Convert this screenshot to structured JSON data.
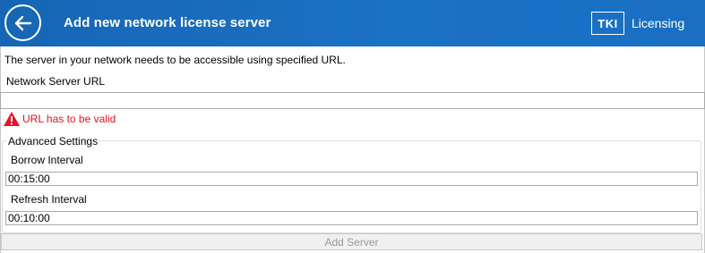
{
  "header": {
    "title": "Add new network license server",
    "back_icon": "arrow-left-icon",
    "brand_logo": "TKI",
    "brand_name": "Licensing",
    "background": "#1a6fc3"
  },
  "form": {
    "intro": "The server in your network needs to be accessible using specified URL.",
    "url_label": "Network Server URL",
    "url_value": "",
    "error_icon": "warning-icon",
    "error_text": "URL has to be valid",
    "error_color": "#e81123",
    "advanced": {
      "legend": "Advanced Settings",
      "borrow_label": "Borrow Interval",
      "borrow_value": "00:15:00",
      "refresh_label": "Refresh Interval",
      "refresh_value": "00:10:00"
    },
    "add_button": "Add Server"
  }
}
